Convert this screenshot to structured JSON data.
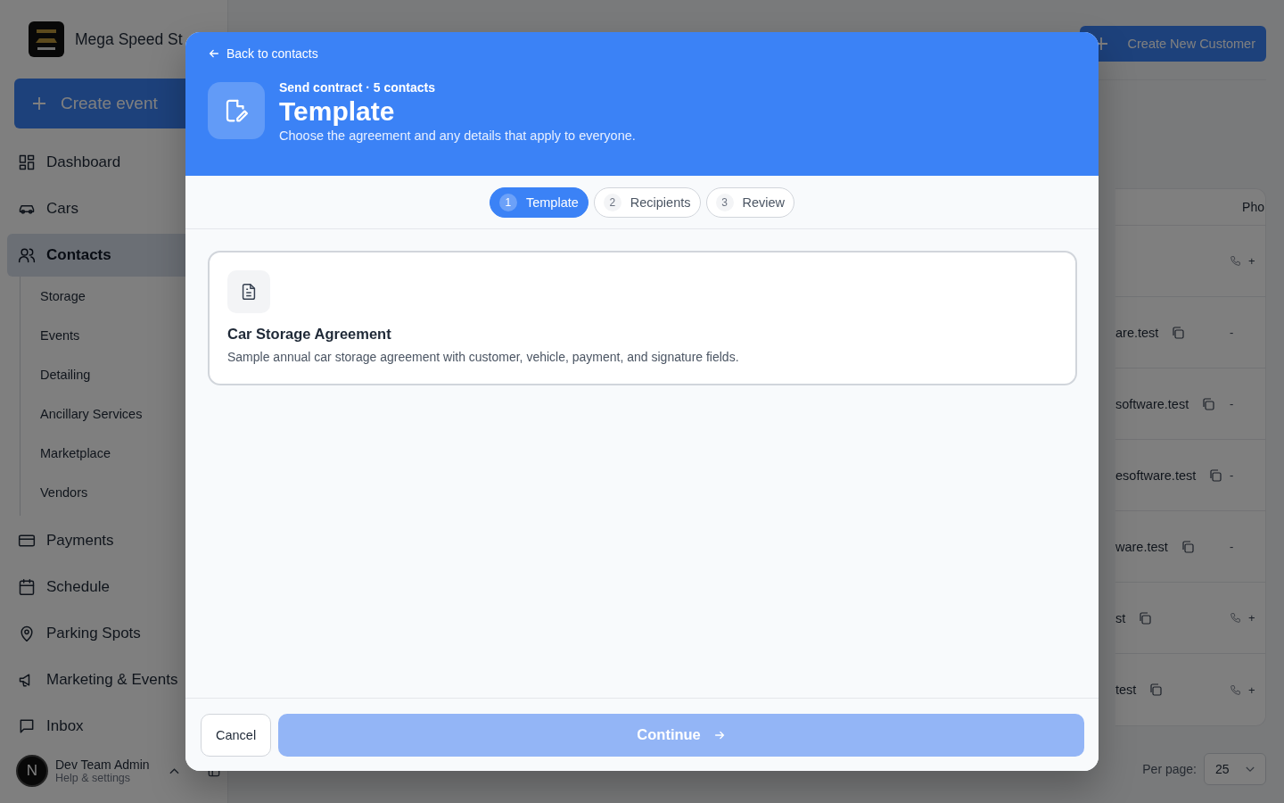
{
  "sidebar": {
    "brand": "Mega Speed St",
    "create_button": "Create event",
    "items": [
      {
        "label": "Dashboard",
        "selected": false
      },
      {
        "label": "Cars",
        "selected": false
      },
      {
        "label": "Contacts",
        "selected": true,
        "children": [
          {
            "label": "Storage"
          },
          {
            "label": "Events"
          },
          {
            "label": "Detailing"
          },
          {
            "label": "Ancillary Services"
          },
          {
            "label": "Marketplace"
          },
          {
            "label": "Vendors"
          }
        ]
      },
      {
        "label": "Payments",
        "selected": false
      },
      {
        "label": "Schedule",
        "selected": false
      },
      {
        "label": "Parking Spots",
        "selected": false
      },
      {
        "label": "Marketing & Events",
        "selected": false
      },
      {
        "label": "Inbox",
        "selected": false
      }
    ],
    "user": {
      "initial": "N",
      "name": "Dev Team Admin",
      "subtitle": "Help & settings"
    }
  },
  "header": {
    "create_button": "Create New Customer"
  },
  "table": {
    "column_heading": "Pho",
    "rows": [
      {
        "email": "",
        "phone": "+"
      },
      {
        "email": "are.test",
        "phone": "-"
      },
      {
        "email": "software.test",
        "phone": "-"
      },
      {
        "email": "esoftware.test",
        "phone": "-"
      },
      {
        "email": "ware.test",
        "phone": "-"
      },
      {
        "email": "st",
        "phone": "+"
      },
      {
        "email": "test",
        "phone": "+"
      }
    ]
  },
  "pagination": {
    "per_page_label": "Per page:",
    "per_page": "25"
  },
  "modal": {
    "back_link": "Back to contacts",
    "eyebrow": "Send contract · 5 contacts",
    "title": "Template",
    "subtitle": "Choose the agreement and any details that apply to everyone.",
    "steps": [
      {
        "number": "1",
        "label": "Template",
        "selected": true
      },
      {
        "number": "2",
        "label": "Recipients",
        "selected": false
      },
      {
        "number": "3",
        "label": "Review",
        "selected": false
      }
    ],
    "templates": [
      {
        "name": "Car Storage Agreement",
        "description": "Sample annual car storage agreement with customer, vehicle, payment, and signature fields."
      }
    ],
    "cancel_button": "Cancel",
    "continue_button": {
      "label": "Continue",
      "disabled": true
    }
  }
}
